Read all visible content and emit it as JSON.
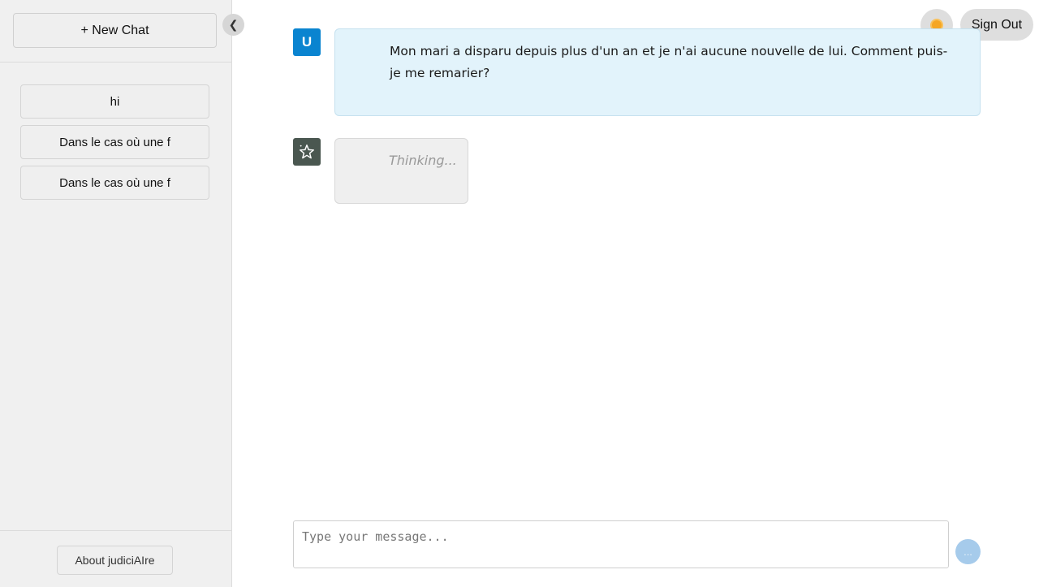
{
  "sidebar": {
    "new_chat_label": "+ New Chat",
    "history": [
      {
        "label": "hi"
      },
      {
        "label": "Dans le cas où une f"
      },
      {
        "label": "Dans le cas où une f"
      }
    ],
    "about_label": "About judiciAIre",
    "collapse_glyph": "❮"
  },
  "header": {
    "theme_icon": "sun-icon",
    "signout_label": "Sign Out"
  },
  "chat": {
    "user_avatar_letter": "U",
    "user_message": "Mon mari a disparu depuis plus d'un an et je n'ai aucune nouvelle de lui. Comment puis-je me remarier?",
    "bot_avatar_icon": "sparkle-star-icon",
    "bot_status": "Thinking..."
  },
  "composer": {
    "placeholder": "Type your message...",
    "send_glyph": "..."
  },
  "colors": {
    "user_bubble_bg": "#e2f3fb",
    "user_avatar_bg": "#0a84d0",
    "bot_avatar_bg": "#4a5750",
    "send_button_bg": "#a6cbeb"
  }
}
